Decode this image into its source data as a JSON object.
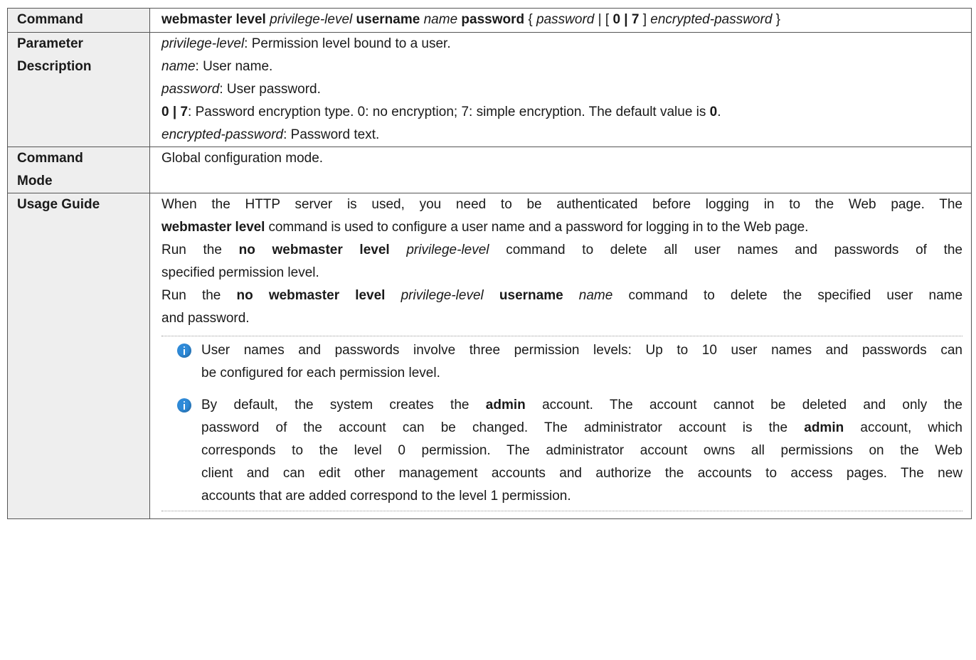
{
  "table": {
    "command": {
      "label": "Command",
      "syntax": {
        "kw1": "webmaster level",
        "arg1": "privilege-level",
        "kw2": "username",
        "arg2": "name",
        "kw3": "password",
        "brace_open": "{",
        "arg3": "password",
        "pipe_bracket": "| [",
        "kw_opts": "0 | 7",
        "bracket_close": "]",
        "arg4": "encrypted-password",
        "brace_close": "}"
      }
    },
    "parameter_description": {
      "label_line1": "Parameter",
      "label_line2": "Description",
      "items": [
        {
          "term": "privilege-level",
          "text": ": Permission level bound to a user."
        },
        {
          "term": "name",
          "text": ": User name."
        },
        {
          "term": "password",
          "text": ": User password."
        },
        {
          "term": "0 | 7",
          "text": ": Password encryption type. 0: no encryption; 7: simple encryption. The default value is ",
          "default_value": "0",
          "end": "."
        },
        {
          "term": "encrypted-password",
          "text": ": Password text."
        }
      ]
    },
    "command_mode": {
      "label_line1": "Command",
      "label_line2": "Mode",
      "text": "Global configuration mode."
    },
    "usage_guide": {
      "label": "Usage Guide",
      "p1_line1": "When the HTTP server is used, you need to be authenticated before logging in to the Web page. The",
      "p1_kw": "webmaster level",
      "p1_line2_rest": " command is used to configure a user name and a password for logging in to the Web page.",
      "p2_run": "Run the ",
      "p2_kw": "no webmaster level",
      "p2_arg": "privilege-level",
      "p2_rest": " command to delete all user names and passwords of the",
      "p2_line2": "specified permission level.",
      "p3_run": "Run the ",
      "p3_kw": "no webmaster level",
      "p3_arg": "privilege-level",
      "p3_kw2": "username",
      "p3_arg2": "name",
      "p3_rest": " command to delete the specified user name",
      "p3_line2": "and password.",
      "notes": [
        {
          "icon": "info-icon",
          "line1": "User names and passwords involve three permission levels: Up to 10 user names and passwords can",
          "line2": "be configured for each permission level."
        },
        {
          "icon": "info-icon",
          "a": "By default, the system creates the ",
          "kw_a": "admin",
          "b": " account. The account cannot be deleted and only the",
          "c": "password of the account can be changed. The administrator account is the ",
          "kw_c": "admin",
          "d": " account, which",
          "line3": "corresponds to the level 0 permission. The administrator account owns all permissions on the Web",
          "line4": "client and can edit other management accounts and authorize the accounts to access pages. The new",
          "line5": "accounts that are added correspond to the level 1 permission."
        }
      ]
    }
  }
}
